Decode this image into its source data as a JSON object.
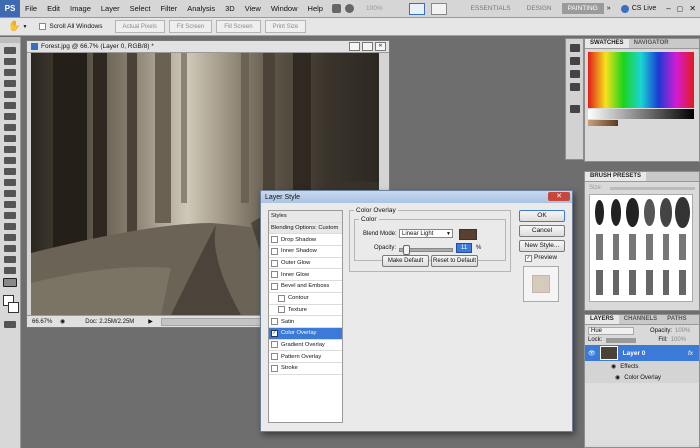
{
  "app": {
    "logo": "PS"
  },
  "menu": [
    "File",
    "Edit",
    "Image",
    "Layer",
    "Select",
    "Filter",
    "Analysis",
    "3D",
    "View",
    "Window",
    "Help"
  ],
  "zoom_readout": "100%",
  "workspaces": [
    "ESSENTIALS",
    "DESIGN",
    "PAINTING"
  ],
  "workspace_active": "PAINTING",
  "cslive": "CS Live",
  "options": {
    "scroll_all": "Scroll All Windows",
    "actual_pixels": "Actual Pixels",
    "fit_screen": "Fit Screen",
    "fill_screen": "Fill Screen",
    "print_size": "Print Size"
  },
  "document": {
    "title": "Forest.jpg @ 66.7% (Layer 0, RGB/8) *",
    "zoom": "66.67%",
    "doc_info": "Doc: 2.25M/2.25M"
  },
  "swatches": {
    "tabs": [
      "SWATCHES",
      "NAVIGATOR"
    ]
  },
  "brush_presets": {
    "tab": "BRUSH PRESETS",
    "size_label": "Size:"
  },
  "layers": {
    "tabs": [
      "LAYERS",
      "CHANNELS",
      "PATHS"
    ],
    "blend": "Hue",
    "opacity_label": "Opacity:",
    "opacity": "100%",
    "lock_label": "Lock:",
    "fill_label": "Fill:",
    "fill": "100%",
    "layer_name": "Layer 0",
    "fx": "fx",
    "effects_label": "Effects",
    "effect_item": "Color Overlay"
  },
  "dialog": {
    "title": "Layer Style",
    "styles": [
      "Styles",
      "Blending Options: Custom",
      "Drop Shadow",
      "Inner Shadow",
      "Outer Glow",
      "Inner Glow",
      "Bevel and Emboss",
      "Contour",
      "Texture",
      "Satin",
      "Color Overlay",
      "Gradient Overlay",
      "Pattern Overlay",
      "Stroke"
    ],
    "active_style": "Color Overlay",
    "section_title": "Color Overlay",
    "group_title": "Color",
    "blend_mode_label": "Blend Mode:",
    "blend_mode": "Linear Light",
    "overlay_color": "#5a4030",
    "opacity_label": "Opacity:",
    "opacity_value": "11",
    "opacity_unit": "%",
    "opacity_fraction": 0.11,
    "make_default": "Make Default",
    "reset_default": "Reset to Default",
    "ok": "OK",
    "cancel": "Cancel",
    "new_style": "New Style...",
    "preview": "Preview"
  }
}
